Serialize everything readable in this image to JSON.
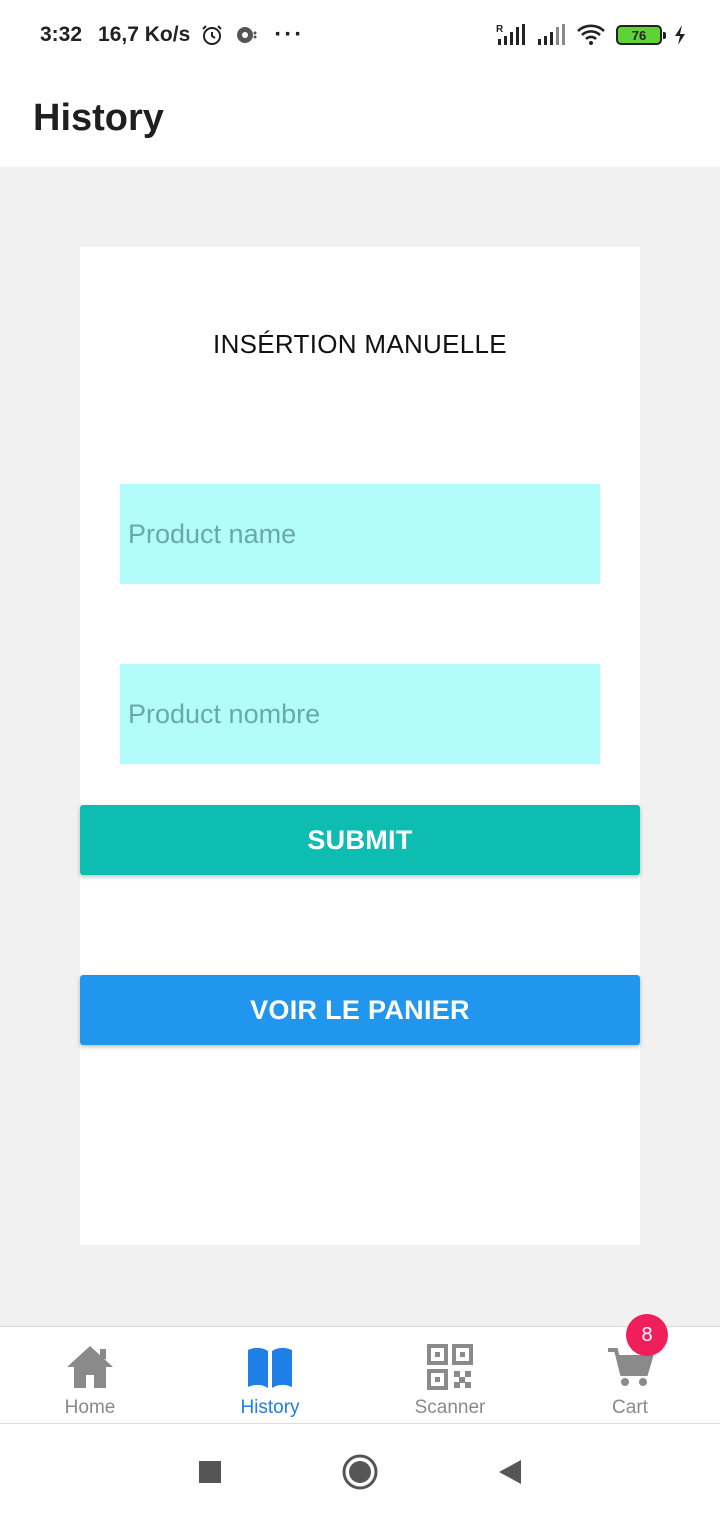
{
  "status_bar": {
    "time": "3:32",
    "net_speed": "16,7 Ko/s",
    "battery_level": "76",
    "icons": [
      "alarm-icon",
      "sync-icon",
      "more-dots-icon",
      "signal-r-icon",
      "signal-icon",
      "wifi-icon",
      "battery-icon",
      "charging-icon"
    ]
  },
  "app_bar": {
    "title": "History"
  },
  "form": {
    "title": "INSÉRTION MANUELLE",
    "product_name_placeholder": "Product name",
    "product_number_placeholder": "Product nombre",
    "submit_label": "SUBMIT",
    "view_cart_label": "VOIR LE PANIER"
  },
  "bottom_nav": {
    "items": [
      {
        "label": "Home",
        "icon": "home-icon",
        "active": false
      },
      {
        "label": "History",
        "icon": "book-icon",
        "active": true
      },
      {
        "label": "Scanner",
        "icon": "qr-code-icon",
        "active": false
      },
      {
        "label": "Cart",
        "icon": "cart-icon",
        "active": false
      }
    ],
    "cart_badge": "8"
  },
  "colors": {
    "submit": "#0ebdb2",
    "view_cart": "#2196ef",
    "input_bg": "#b3fcfc",
    "active_nav": "#1e7fe6",
    "badge": "#ef1f5b"
  }
}
